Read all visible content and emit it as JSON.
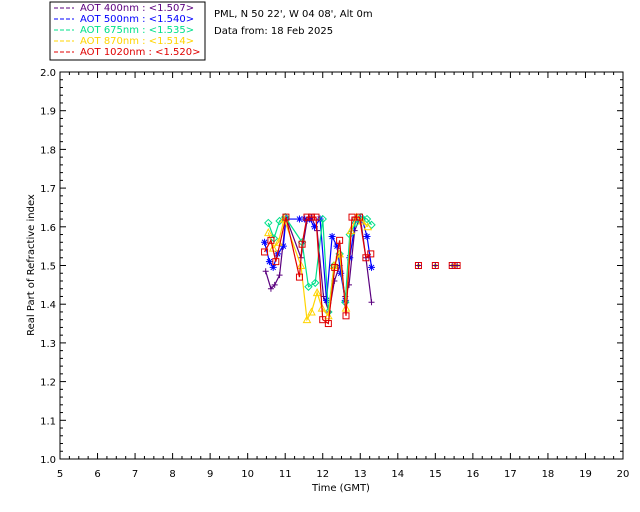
{
  "header": {
    "site": "PML, N 50 22', W 04 08', Alt 0m",
    "date": "Data from: 18 Feb 2025"
  },
  "legend": [
    {
      "label": "AOT  400nm : <1.507>",
      "color": "#5a007f"
    },
    {
      "label": "AOT  500nm : <1.540>",
      "color": "#0000ff"
    },
    {
      "label": "AOT  675nm : <1.535>",
      "color": "#00e08a"
    },
    {
      "label": "AOT  870nm : <1.514>",
      "color": "#ffd400"
    },
    {
      "label": "AOT 1020nm : <1.520>",
      "color": "#e00000"
    }
  ],
  "chart_data": {
    "type": "line",
    "xlabel": "Time (GMT)",
    "ylabel": "Real Part of Refractive index",
    "xlim": [
      5,
      20
    ],
    "ylim": [
      1.0,
      2.0
    ],
    "xticks": [
      "5",
      "6",
      "7",
      "8",
      "9",
      "10",
      "11",
      "12",
      "13",
      "14",
      "15",
      "16",
      "17",
      "18",
      "19",
      "20"
    ],
    "yticks": [
      "1.0",
      "1.1",
      "1.2",
      "1.3",
      "1.4",
      "1.5",
      "1.6",
      "1.7",
      "1.8",
      "1.9",
      "2.0"
    ],
    "grid": false,
    "series": [
      {
        "name": "AOT  400nm",
        "color": "#5a007f",
        "marker": "plus",
        "x": [
          10.48,
          10.62,
          10.72,
          10.85,
          11.02,
          11.42,
          11.58,
          11.7,
          11.85,
          12.02,
          12.17,
          12.31,
          12.45,
          12.6,
          12.7,
          12.85,
          13.0,
          13.15,
          13.3
        ],
        "y": [
          1.485,
          1.44,
          1.45,
          1.475,
          1.625,
          1.52,
          1.615,
          1.625,
          1.59,
          1.42,
          1.38,
          1.46,
          1.5,
          1.42,
          1.45,
          1.59,
          1.625,
          1.52,
          1.405
        ]
      },
      {
        "name": "AOT  500nm",
        "color": "#0000ff",
        "marker": "asterisk",
        "x": [
          10.45,
          10.58,
          10.68,
          10.8,
          10.95,
          11.02,
          11.38,
          11.52,
          11.65,
          11.78,
          11.93,
          12.1,
          12.25,
          12.38,
          12.48,
          12.6,
          12.72,
          12.88,
          13.05,
          13.18,
          13.3
        ],
        "y": [
          1.56,
          1.51,
          1.495,
          1.53,
          1.55,
          1.62,
          1.62,
          1.62,
          1.62,
          1.6,
          1.62,
          1.41,
          1.575,
          1.55,
          1.48,
          1.41,
          1.52,
          1.62,
          1.62,
          1.575,
          1.495
        ]
      },
      {
        "name": "AOT  675nm",
        "color": "#00e08a",
        "marker": "diamond",
        "x": [
          10.55,
          10.7,
          10.85,
          11.0,
          11.45,
          11.62,
          11.8,
          12.0,
          12.15,
          12.3,
          12.45,
          12.6,
          12.72,
          12.88,
          13.02,
          13.18,
          13.3
        ],
        "y": [
          1.61,
          1.57,
          1.615,
          1.625,
          1.56,
          1.445,
          1.455,
          1.62,
          1.38,
          1.5,
          1.53,
          1.405,
          1.58,
          1.61,
          1.625,
          1.62,
          1.605
        ]
      },
      {
        "name": "AOT  870nm",
        "color": "#ffd400",
        "marker": "triangle",
        "x": [
          10.55,
          10.68,
          10.82,
          10.97,
          11.42,
          11.58,
          11.7,
          11.85,
          11.98,
          12.15,
          12.3,
          12.45,
          12.62,
          12.75,
          12.9,
          13.05,
          13.2
        ],
        "y": [
          1.585,
          1.545,
          1.56,
          1.62,
          1.5,
          1.36,
          1.38,
          1.43,
          1.39,
          1.37,
          1.5,
          1.53,
          1.39,
          1.59,
          1.625,
          1.615,
          1.6
        ]
      },
      {
        "name": "AOT 1020nm",
        "color": "#e00000",
        "marker": "square",
        "x": [
          10.45,
          10.62,
          10.75,
          11.02,
          11.38,
          11.45,
          11.58,
          11.7,
          11.82,
          12.0,
          12.15,
          12.32,
          12.45,
          12.62,
          12.78,
          12.98,
          13.15,
          13.28
        ],
        "y": [
          1.535,
          1.565,
          1.51,
          1.625,
          1.47,
          1.555,
          1.625,
          1.625,
          1.625,
          1.36,
          1.35,
          1.495,
          1.565,
          1.37,
          1.625,
          1.625,
          1.52,
          1.53
        ]
      }
    ],
    "isolated_points": {
      "x": [
        14.55,
        15.0,
        15.45,
        15.58
      ],
      "y": [
        1.5,
        1.5,
        1.5,
        1.5
      ]
    }
  }
}
